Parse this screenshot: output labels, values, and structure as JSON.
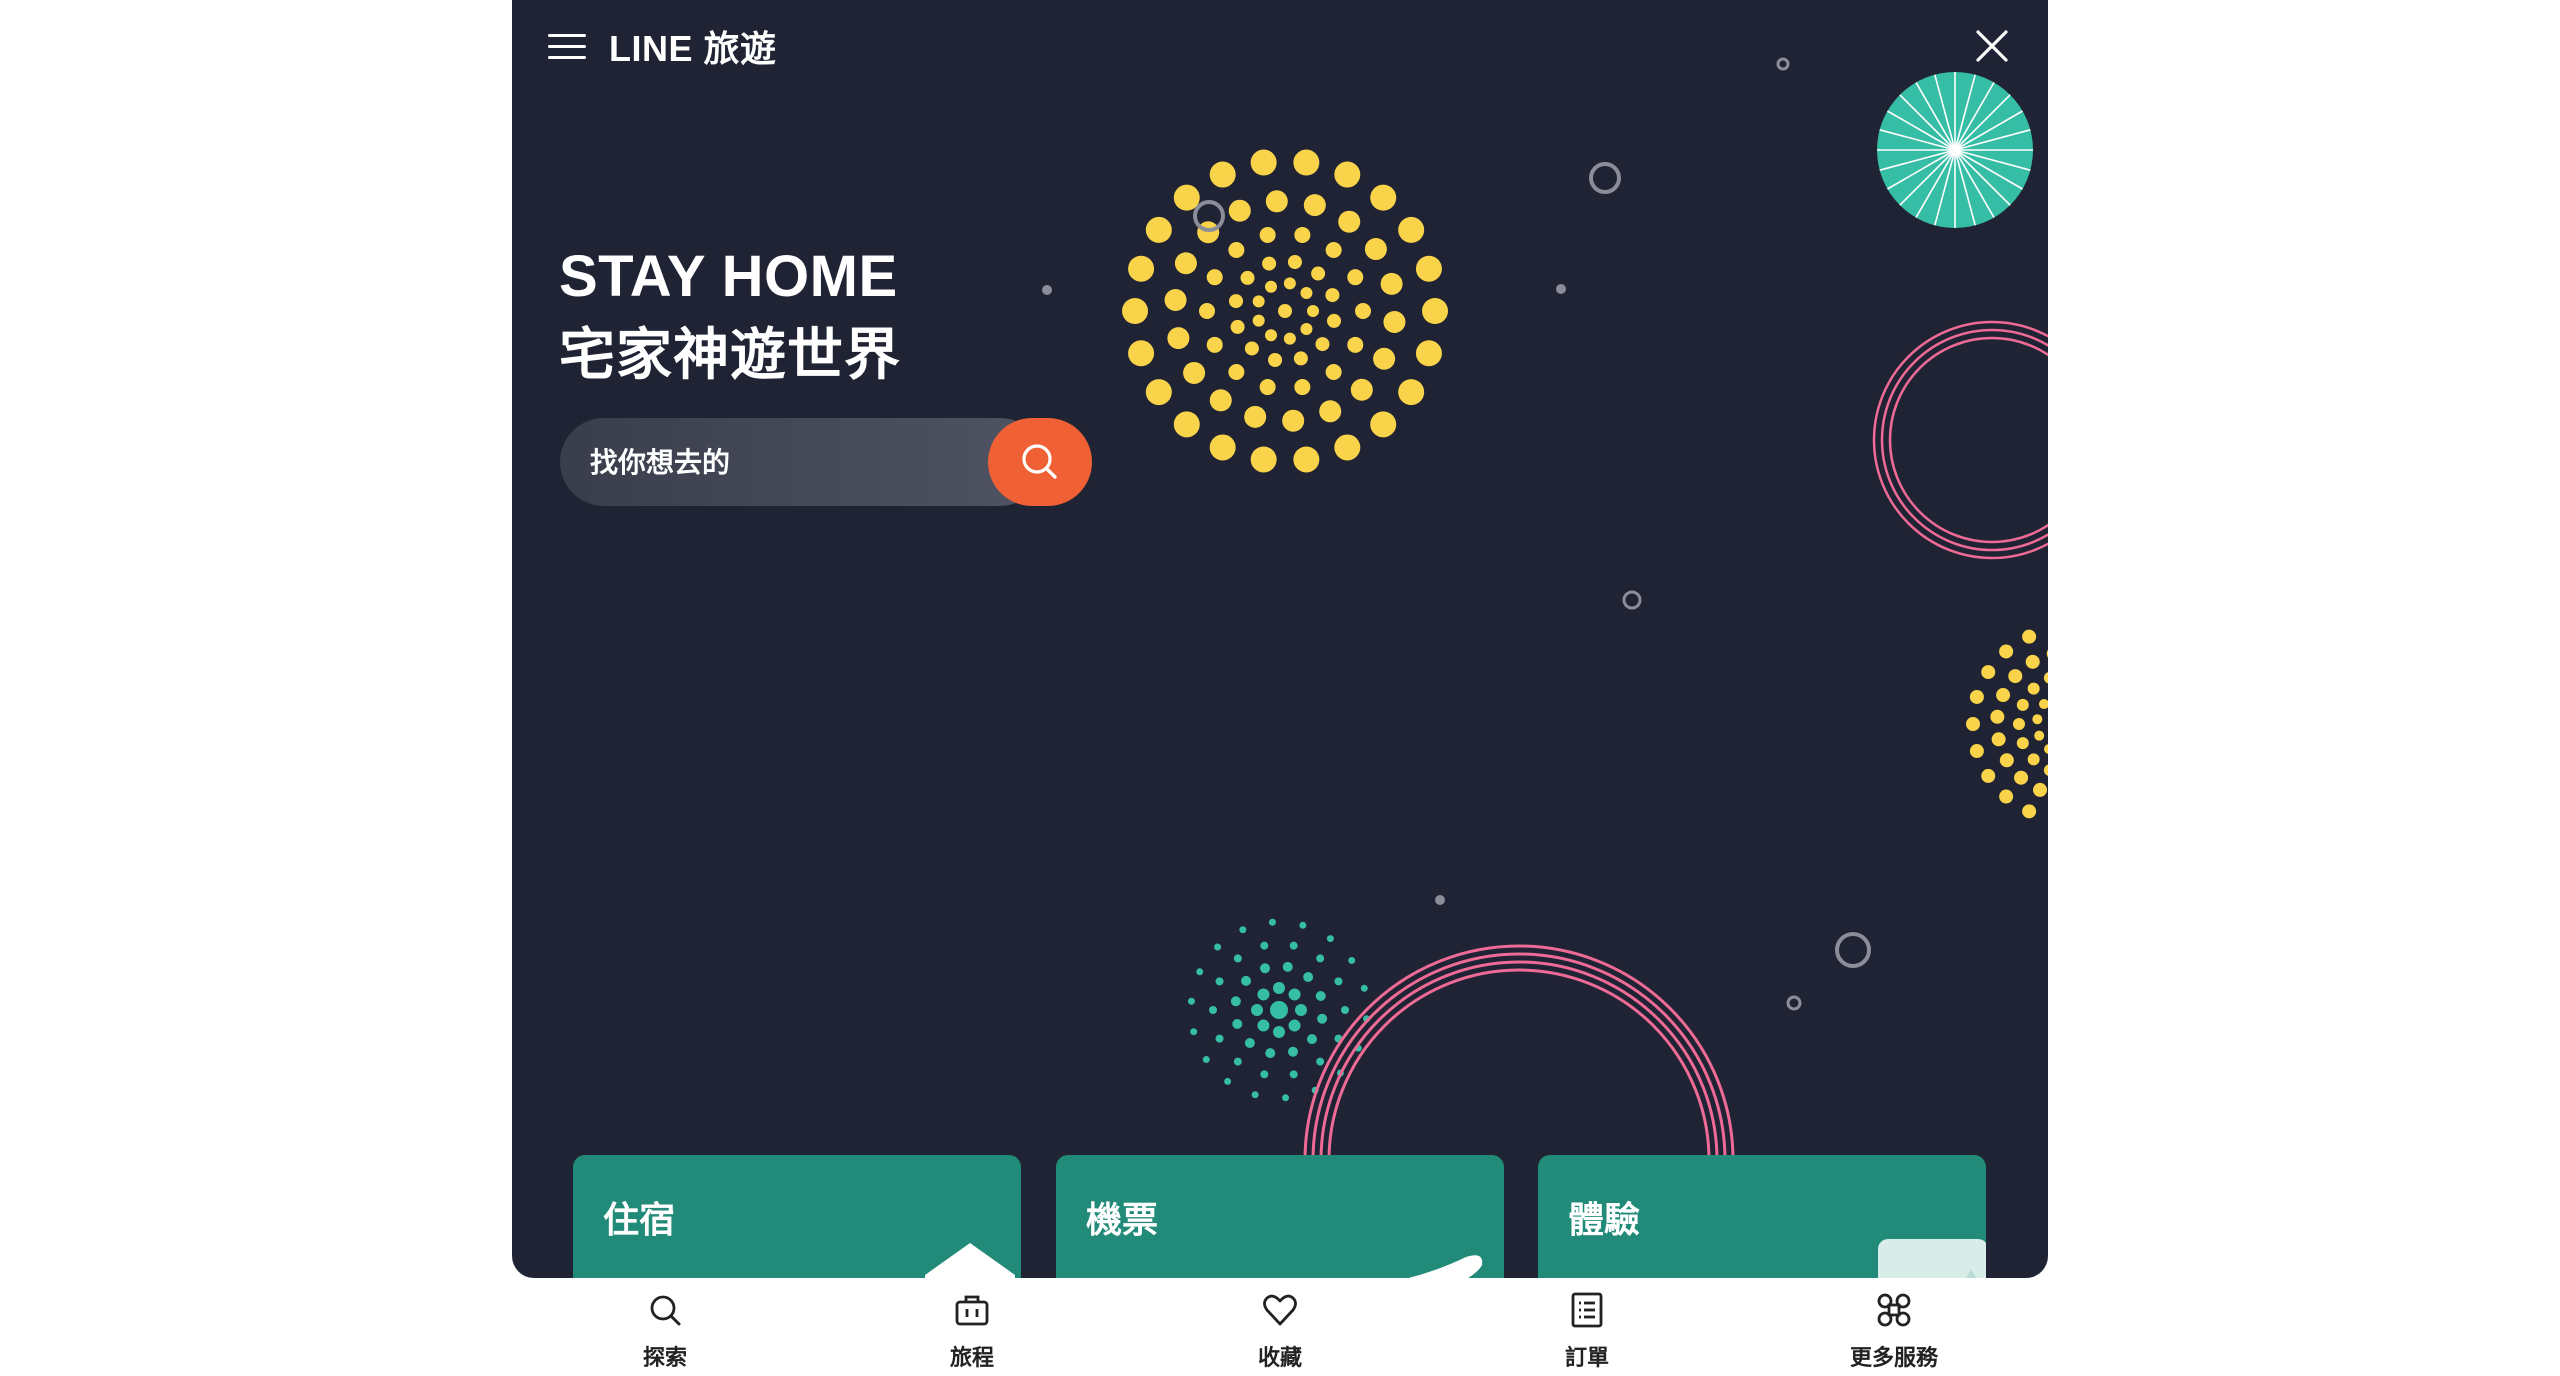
{
  "header": {
    "brand": "LINE 旅遊",
    "menu_icon": "hamburger-menu-icon",
    "close_icon": "close-icon"
  },
  "hero": {
    "title_line1": "STAY HOME",
    "title_line2": "宅家神遊世界",
    "background_color": "#1f2333"
  },
  "search": {
    "placeholder": "找你想去的",
    "button_icon": "search-icon",
    "button_color": "#ef6134"
  },
  "categories": [
    {
      "label": "住宿",
      "icon": "house-icon"
    },
    {
      "label": "機票",
      "icon": "airplane-icon"
    },
    {
      "label": "體驗",
      "icon": "experience-icon"
    }
  ],
  "bottom_nav": [
    {
      "label": "探索",
      "icon": "search-icon"
    },
    {
      "label": "旅程",
      "icon": "briefcase-icon"
    },
    {
      "label": "收藏",
      "icon": "heart-icon"
    },
    {
      "label": "訂單",
      "icon": "order-list-icon"
    },
    {
      "label": "更多服務",
      "icon": "more-services-icon"
    }
  ],
  "colors": {
    "accent": "#ef6134",
    "card_green": "#228a78",
    "firework_yellow": "#f9d44a",
    "firework_pink": "#ee6b96",
    "firework_teal": "#36bda5"
  }
}
